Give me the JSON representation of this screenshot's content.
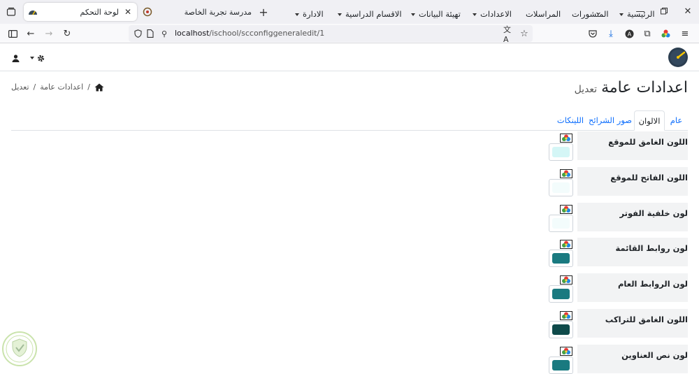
{
  "browser": {
    "tabs": [
      {
        "title": "لوحة التحكم",
        "active": true
      },
      {
        "title": "مدرسة تجربة الخاصة",
        "active": false
      }
    ],
    "url_host": "localhost",
    "url_path": "/ischool/scconfiggeneraledit/1"
  },
  "navbar": {
    "items": [
      {
        "label": "الرئيسية",
        "dropdown": true
      },
      {
        "label": "المنشورات",
        "dropdown": false
      },
      {
        "label": "المراسلات",
        "dropdown": false
      },
      {
        "label": "الاعدادات",
        "dropdown": true
      },
      {
        "label": "تهيئة البيانات",
        "dropdown": true
      },
      {
        "label": "الاقسام الدراسية",
        "dropdown": true
      },
      {
        "label": "الادارة",
        "dropdown": true
      }
    ]
  },
  "page": {
    "title": "اعدادات عامة",
    "subtitle": "تعديل",
    "breadcrumb": [
      "اعدادات عامة",
      "تعديل"
    ]
  },
  "tabs": [
    {
      "label": "عام",
      "active": false
    },
    {
      "label": "الالوان",
      "active": true
    },
    {
      "label": "صور الشرائح",
      "active": false
    },
    {
      "label": "اللينكات",
      "active": false
    }
  ],
  "colors": [
    {
      "label": "اللون الغامق للموقع",
      "value": "#d4f6f6"
    },
    {
      "label": "اللون الفاتح للموقع",
      "value": "#f3fcfc"
    },
    {
      "label": "لون خلفية الفوتر",
      "value": "#f3fcfc"
    },
    {
      "label": "لون روابط القائمة",
      "value": "#1a7a80"
    },
    {
      "label": "لون الروابط العام",
      "value": "#1a7a80"
    },
    {
      "label": "اللون الغامق للتراكب",
      "value": "#0e4a4a"
    },
    {
      "label": "لون نص العناوين",
      "value": "#1a7a80"
    }
  ]
}
